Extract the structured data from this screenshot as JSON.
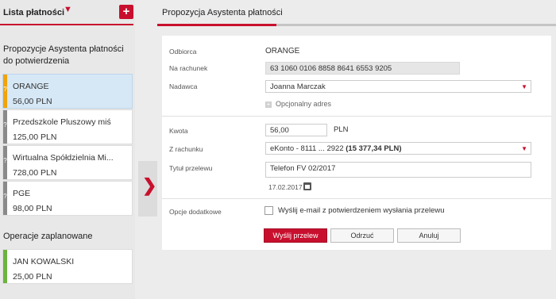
{
  "left": {
    "title": "Lista płatności",
    "plus": "+",
    "section_proposals": "Propozycje Asystenta płatności do potwierdzenia",
    "proposals": [
      {
        "name": "ORANGE",
        "amount": "56,00 PLN",
        "bar_color": "#f0a30a",
        "mark": "?"
      },
      {
        "name": "Przedszkole Pluszowy miś",
        "amount": "125,00 PLN",
        "bar_color": "#8a8a8a",
        "mark": "?"
      },
      {
        "name": "Wirtualna Spółdzielnia Mi...",
        "amount": "728,00 PLN",
        "bar_color": "#8a8a8a",
        "mark": "?"
      },
      {
        "name": "PGE",
        "amount": "98,00 PLN",
        "bar_color": "#8a8a8a",
        "mark": "?"
      }
    ],
    "section_scheduled": "Operacje zaplanowane",
    "scheduled": [
      {
        "name": "JAN KOWALSKI",
        "amount": "25,00 PLN",
        "bar_color": "#6cb33f"
      }
    ]
  },
  "right": {
    "title": "Propozycja Asystenta płatności",
    "form": {
      "recipient_label": "Odbiorca",
      "recipient_value": "ORANGE",
      "account_label": "Na rachunek",
      "account_value": "63 1060 0106 8858 8641 6553 9205",
      "sender_label": "Nadawca",
      "sender_value": "Joanna Marczak",
      "optional_address": "Opcjonalny adres",
      "amount_label": "Kwota",
      "amount_value": "56,00",
      "currency": "PLN",
      "from_account_label": "Z rachunku",
      "from_account_value": "eKonto - 8111 ... 2922",
      "from_account_balance": "(15 377,34 PLN)",
      "title_label": "Tytuł przelewu",
      "title_value": "Telefon FV 02/2017",
      "date_value": "17.02.2017",
      "options_label": "Opcje dodatkowe",
      "email_option": "Wyślij e-mail z potwierdzeniem wysłania przelewu"
    },
    "buttons": {
      "send": "Wyślij przelew",
      "reject": "Odrzuć",
      "cancel": "Anuluj"
    }
  },
  "colors": {
    "accent": "#c8102e",
    "selected_card": "#d6e8f6"
  }
}
